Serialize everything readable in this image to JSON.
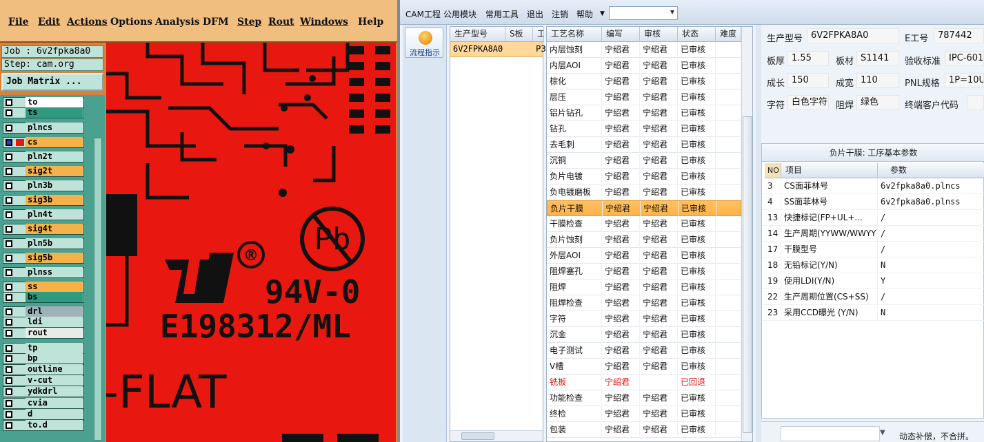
{
  "cam": {
    "menu": [
      "File",
      "Edit",
      "Actions",
      "Options",
      "Analysis",
      "DFM",
      "Step",
      "Rout",
      "Windows",
      "Help"
    ],
    "job_label": "Job : 6v2fpka8a0",
    "step_label": "Step: cam.org",
    "job_matrix_label": "Job Matrix ...",
    "layers": [
      {
        "name": "to",
        "color": "#ffffff"
      },
      {
        "name": "ts",
        "color": "#2e9b80"
      },
      {
        "name": "plncs",
        "color": "#bfe3d8"
      },
      {
        "name": "cs",
        "color": "#f5b24a"
      },
      {
        "name": "pln2t",
        "color": "#bfe3d8"
      },
      {
        "name": "sig2t",
        "color": "#f5b24a"
      },
      {
        "name": "pln3b",
        "color": "#bfe3d8"
      },
      {
        "name": "sig3b",
        "color": "#f5b24a"
      },
      {
        "name": "pln4t",
        "color": "#bfe3d8"
      },
      {
        "name": "sig4t",
        "color": "#f5b24a"
      },
      {
        "name": "pln5b",
        "color": "#bfe3d8"
      },
      {
        "name": "sig5b",
        "color": "#f5b24a"
      },
      {
        "name": "plnss",
        "color": "#bfe3d8"
      },
      {
        "name": "ss",
        "color": "#f5b24a"
      },
      {
        "name": "bs",
        "color": "#2e9b80"
      },
      {
        "name": "drl",
        "color": "#9fb2b8"
      },
      {
        "name": "ldi",
        "color": "#bfe3d8"
      },
      {
        "name": "rout",
        "color": "#e8ece9"
      },
      {
        "name": "tp",
        "color": "#bfe3d8"
      },
      {
        "name": "bp",
        "color": "#bfe3d8"
      },
      {
        "name": "outline",
        "color": "#bfe3d8"
      },
      {
        "name": "v-cut",
        "color": "#bfe3d8"
      },
      {
        "name": "ydkdrl",
        "color": "#bfe3d8"
      },
      {
        "name": "cvia",
        "color": "#bfe3d8"
      },
      {
        "name": "d",
        "color": "#bfe3d8"
      },
      {
        "name": "to.d",
        "color": "#bfe3d8"
      }
    ],
    "canvas_text": {
      "reg": "®",
      "rating": "94V-0",
      "ul_number": "E198312/ML",
      "flat": "-FLAT",
      "pb": "Pb"
    }
  },
  "app": {
    "menu": [
      "CAM工程",
      "公用模块",
      "常用工具",
      "退出",
      "注销",
      "帮助"
    ],
    "flow_button": "流程指示",
    "grid_a": {
      "headers": [
        "生产型号",
        "S板",
        "工"
      ],
      "row": {
        "model": "6V2FPKA8A0",
        "tail": "P3"
      }
    },
    "grid_b": {
      "headers": [
        "工艺名称",
        "编写",
        "审核",
        "状态",
        "难度"
      ],
      "rows": [
        [
          "内层蚀刻",
          "宁绍君",
          "宁绍君",
          "已审核"
        ],
        [
          "内层AOI",
          "宁绍君",
          "宁绍君",
          "已审核"
        ],
        [
          "棕化",
          "宁绍君",
          "宁绍君",
          "已审核"
        ],
        [
          "层压",
          "宁绍君",
          "宁绍君",
          "已审核"
        ],
        [
          "铝片钻孔",
          "宁绍君",
          "宁绍君",
          "已审核"
        ],
        [
          "钻孔",
          "宁绍君",
          "宁绍君",
          "已审核"
        ],
        [
          "去毛刺",
          "宁绍君",
          "宁绍君",
          "已审核"
        ],
        [
          "沉铜",
          "宁绍君",
          "宁绍君",
          "已审核"
        ],
        [
          "负片电镀",
          "宁绍君",
          "宁绍君",
          "已审核"
        ],
        [
          "负电镀磨板",
          "宁绍君",
          "宁绍君",
          "已审核"
        ],
        [
          "负片干膜",
          "宁绍君",
          "宁绍君",
          "已审核"
        ],
        [
          "干膜检查",
          "宁绍君",
          "宁绍君",
          "已审核"
        ],
        [
          "负片蚀刻",
          "宁绍君",
          "宁绍君",
          "已审核"
        ],
        [
          "外层AOI",
          "宁绍君",
          "宁绍君",
          "已审核"
        ],
        [
          "阻焊塞孔",
          "宁绍君",
          "宁绍君",
          "已审核"
        ],
        [
          "阻焊",
          "宁绍君",
          "宁绍君",
          "已审核"
        ],
        [
          "阻焊检查",
          "宁绍君",
          "宁绍君",
          "已审核"
        ],
        [
          "字符",
          "宁绍君",
          "宁绍君",
          "已审核"
        ],
        [
          "沉金",
          "宁绍君",
          "宁绍君",
          "已审核"
        ],
        [
          "电子测试",
          "宁绍君",
          "宁绍君",
          "已审核"
        ],
        [
          "V槽",
          "宁绍君",
          "宁绍君",
          "已审核"
        ],
        [
          "铣板",
          "宁绍君",
          "",
          "已回退"
        ],
        [
          "功能检查",
          "宁绍君",
          "宁绍君",
          "已审核"
        ],
        [
          "终检",
          "宁绍君",
          "宁绍君",
          "已审核"
        ],
        [
          "包装",
          "宁绍君",
          "宁绍君",
          "已审核"
        ]
      ],
      "selected_index": 10,
      "rejected_index": 21,
      "reject_color": "#e0140e",
      "selected_color": "#ffc060"
    },
    "info": {
      "model_label": "生产型号",
      "model_value": "6V2FPKA8A0",
      "eno_label": "E工号",
      "eno_value": "787442",
      "thick_label": "板厚",
      "thick_value": "1.55",
      "mat_label": "板材",
      "mat_value": "S1141",
      "std_label": "验收标准",
      "std_value": "IPC-601",
      "len_label": "成长",
      "len_value": "150",
      "wid_label": "成宽",
      "wid_value": "110",
      "pnl_label": "PNL规格",
      "pnl_value": "1P=10U",
      "char_label": "字符",
      "char_value": "白色字符",
      "mask_label": "阻焊",
      "mask_value": "绿色",
      "cust_label": "终端客户代码",
      "cust_value": ""
    },
    "params": {
      "title": "负片干膜: 工序基本参数",
      "headers": [
        "NO",
        "项目",
        "参数"
      ],
      "rows": [
        [
          "3",
          "CS面菲林号",
          "6v2fpka8a0.plncs"
        ],
        [
          "4",
          "SS面菲林号",
          "6v2fpka8a0.plnss"
        ],
        [
          "13",
          "快捷标记(FP+UL+...",
          "/"
        ],
        [
          "14",
          "生产周期(YYWW/WWYY)",
          "/"
        ],
        [
          "17",
          "干膜型号",
          "/"
        ],
        [
          "18",
          "无铅标记(Y/N)",
          "N"
        ],
        [
          "19",
          "使用LDI(Y/N)",
          "Y"
        ],
        [
          "22",
          "生产周期位置(CS+SS)",
          "/"
        ],
        [
          "23",
          "采用CCD曝光 (Y/N)",
          "N"
        ]
      ]
    },
    "status_text": "动态补偿，不合拼。"
  }
}
